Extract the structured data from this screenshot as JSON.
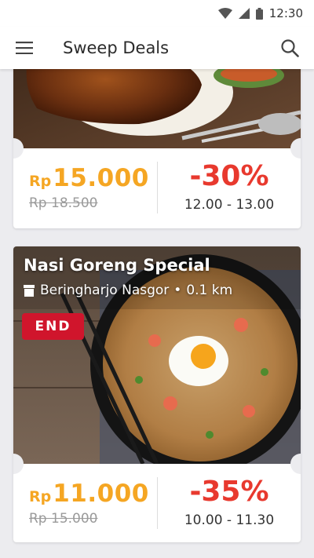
{
  "status_bar": {
    "time": "12:30",
    "icons": [
      "wifi-icon",
      "signal-icon",
      "battery-icon"
    ]
  },
  "app_bar": {
    "title": "Sweep Deals",
    "left_icon": "hamburger-menu-icon",
    "right_icon": "search-icon"
  },
  "deals": [
    {
      "title": "",
      "deal_price_currency": "Rp",
      "deal_price_amount": "15.000",
      "original_price": "Rp 18.500",
      "discount": "-30%",
      "hours": "12.00 - 13.00",
      "image": "grilled-chicken-photo"
    },
    {
      "title": "Nasi Goreng Special",
      "merchant": "Beringharjo Nasgor",
      "distance": "0.1 km",
      "status_badge": "END",
      "deal_price_currency": "Rp",
      "deal_price_amount": "11.000",
      "original_price": "Rp 15.000",
      "discount": "-35%",
      "hours": "10.00 - 11.30",
      "image": "fried-rice-photo"
    }
  ],
  "colors": {
    "deal_price": "#f5a623",
    "discount": "#e8392e",
    "end_badge": "#d0152c",
    "background": "#ececef"
  }
}
